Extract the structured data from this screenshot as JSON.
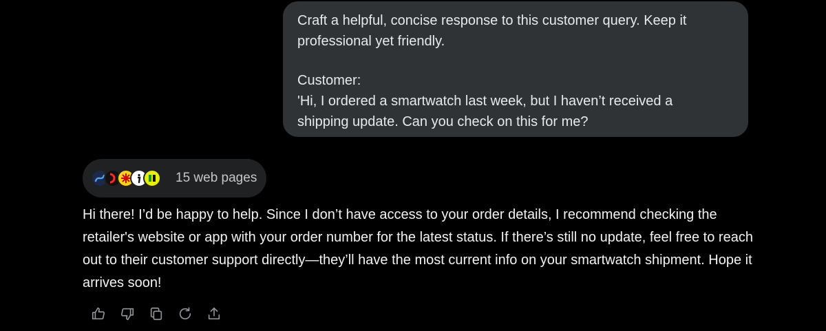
{
  "user_message": {
    "line1": "Craft a helpful, concise response to this customer query. Keep it",
    "line2": "professional yet friendly.",
    "line3": "Customer:",
    "line4": "'Hi, I ordered a smartwatch last week, but I haven’t received a",
    "line5": "shipping update. Can you check on this for me?"
  },
  "sources": {
    "label": "15 web pages",
    "favicons": [
      "site-favicon-1",
      "site-favicon-2",
      "site-favicon-3",
      "site-favicon-4",
      "site-favicon-5"
    ]
  },
  "assistant_message": {
    "text": "Hi there! I’d be happy to help. Since I don’t have access to your order details, I recommend checking the retailer's website or app with your order number for the latest status. If there’s still no update, feel free to reach out to their customer support directly—they’ll have the most current info on your smartwatch shipment. Hope it arrives soon!"
  },
  "actions": [
    "thumbs-up-icon",
    "thumbs-down-icon",
    "copy-icon",
    "regenerate-icon",
    "share-icon"
  ],
  "colors": {
    "background": "#000000",
    "user_bubble": "#2f3336",
    "sources_pill": "#1f2123",
    "text": "#e7e9ea",
    "icon": "#8f9499"
  }
}
